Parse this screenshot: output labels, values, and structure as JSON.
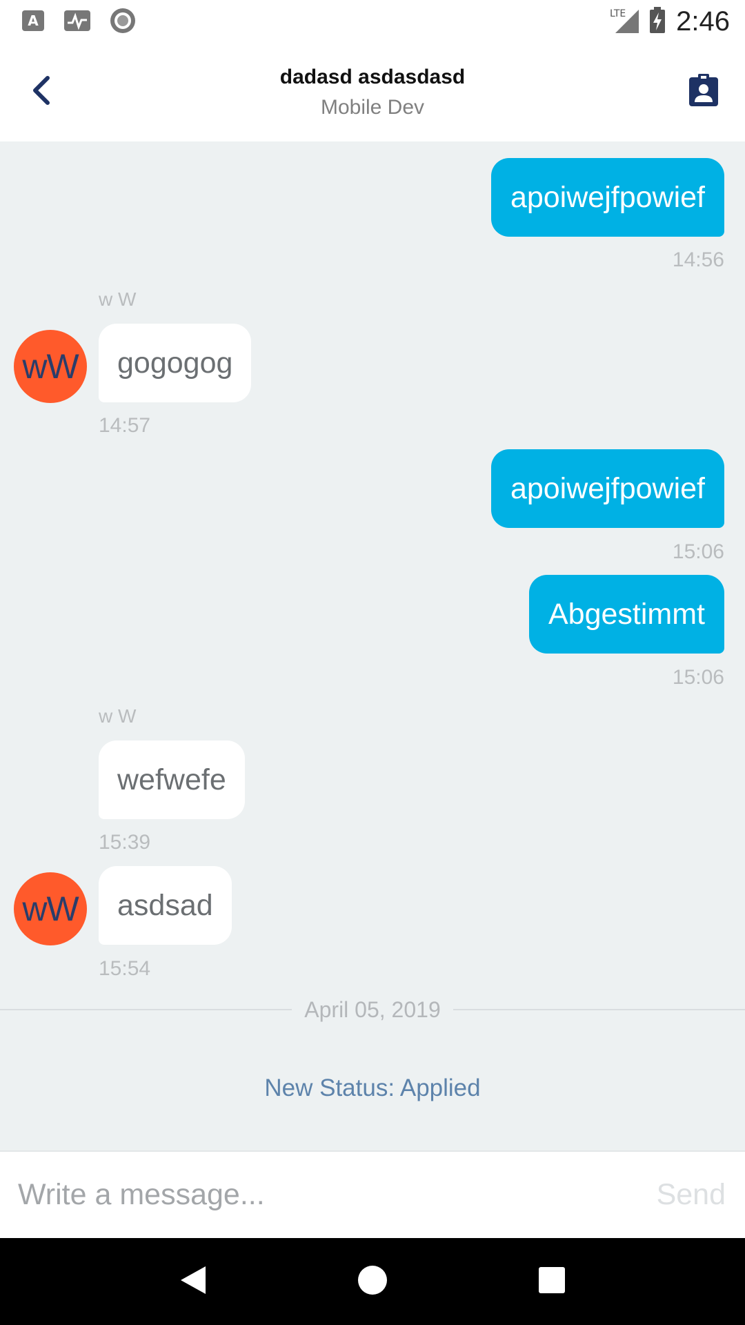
{
  "status_bar": {
    "time": "2:46",
    "network": "LTE",
    "icons": [
      "a-letter-icon",
      "activity-icon",
      "record-icon",
      "signal-icon",
      "battery-charging-icon"
    ]
  },
  "header": {
    "title": "dadasd asdasdasd",
    "subtitle": "Mobile Dev",
    "back_icon": "chevron-left-icon",
    "profile_icon": "contact-badge-icon"
  },
  "messages": [
    {
      "direction": "out",
      "text": "apoiwejfpowief",
      "time": "14:56"
    },
    {
      "direction": "in",
      "sender": "w W",
      "initials": "wW",
      "text": "gogogog",
      "time": "14:57"
    },
    {
      "direction": "out",
      "text": "apoiwejfpowief",
      "time": "15:06"
    },
    {
      "direction": "out",
      "text": "Abgestimmt",
      "time": "15:06"
    },
    {
      "direction": "in",
      "sender": "w W",
      "text": "wefwefe",
      "time": "15:39"
    },
    {
      "direction": "in",
      "initials": "wW",
      "text": "asdsad",
      "time": "15:54"
    }
  ],
  "date_separator": "April 05, 2019",
  "status_update": "New Status: Applied",
  "composer": {
    "placeholder": "Write a message...",
    "send_label": "Send"
  },
  "colors": {
    "outgoing_bubble": "#00b1e4",
    "incoming_bubble": "#ffffff",
    "avatar": "#ff5a2b",
    "chat_background": "#edf1f2",
    "status_text": "#5d83ab",
    "header_icon": "#1e3264"
  }
}
